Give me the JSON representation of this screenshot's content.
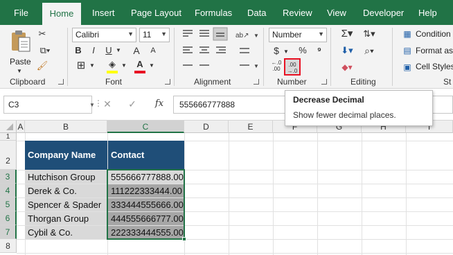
{
  "menu": {
    "tabs": [
      {
        "label": "File"
      },
      {
        "label": "Home"
      },
      {
        "label": "Insert"
      },
      {
        "label": "Page Layout"
      },
      {
        "label": "Formulas"
      },
      {
        "label": "Data"
      },
      {
        "label": "Review"
      },
      {
        "label": "View"
      },
      {
        "label": "Developer"
      },
      {
        "label": "Help"
      }
    ],
    "active_tab": "Home"
  },
  "ribbon": {
    "clipboard": {
      "paste_label": "Paste",
      "group_label": "Clipboard"
    },
    "font": {
      "font_name": "Calibri",
      "font_size": "11",
      "bold": "B",
      "italic": "I",
      "underline": "U",
      "grow": "A",
      "shrink": "A",
      "group_label": "Font"
    },
    "alignment": {
      "group_label": "Alignment"
    },
    "number": {
      "format": "Number",
      "currency": "$",
      "percent": "%",
      "increase_decimal": "←.0\n.00",
      "decrease_decimal": ".00\n→.0",
      "group_label": "Number"
    },
    "editing": {
      "group_label": "Editing"
    },
    "styles": {
      "conditional": "Condition",
      "format_as": "Format as",
      "cell_styles": "Cell Styles",
      "group_label": "St"
    }
  },
  "formula_bar": {
    "name_box": "C3",
    "fx": "fx",
    "value": "555666777888"
  },
  "tooltip": {
    "title": "Decrease Decimal",
    "description": "Show fewer decimal places."
  },
  "grid": {
    "columns": [
      "A",
      "B",
      "C",
      "D",
      "E",
      "F",
      "G",
      "H",
      "I"
    ],
    "rows": [
      "1",
      "2",
      "3",
      "4",
      "5",
      "6",
      "7",
      "8"
    ],
    "header": {
      "company": "Company Name",
      "contact": "Contact"
    },
    "data": [
      {
        "company": "Hutchison Group",
        "contact": "555666777888.00"
      },
      {
        "company": "Derek & Co.",
        "contact": "111222333444.00"
      },
      {
        "company": "Spencer & Spader",
        "contact": "333444555666.00"
      },
      {
        "company": "Thorgan Group",
        "contact": "444555666777.00"
      },
      {
        "company": "Cybil & Co.",
        "contact": "222333444555.00"
      }
    ]
  },
  "colors": {
    "excel_green": "#217346",
    "header_blue": "#1f4e78",
    "highlight_red": "#e81123"
  }
}
